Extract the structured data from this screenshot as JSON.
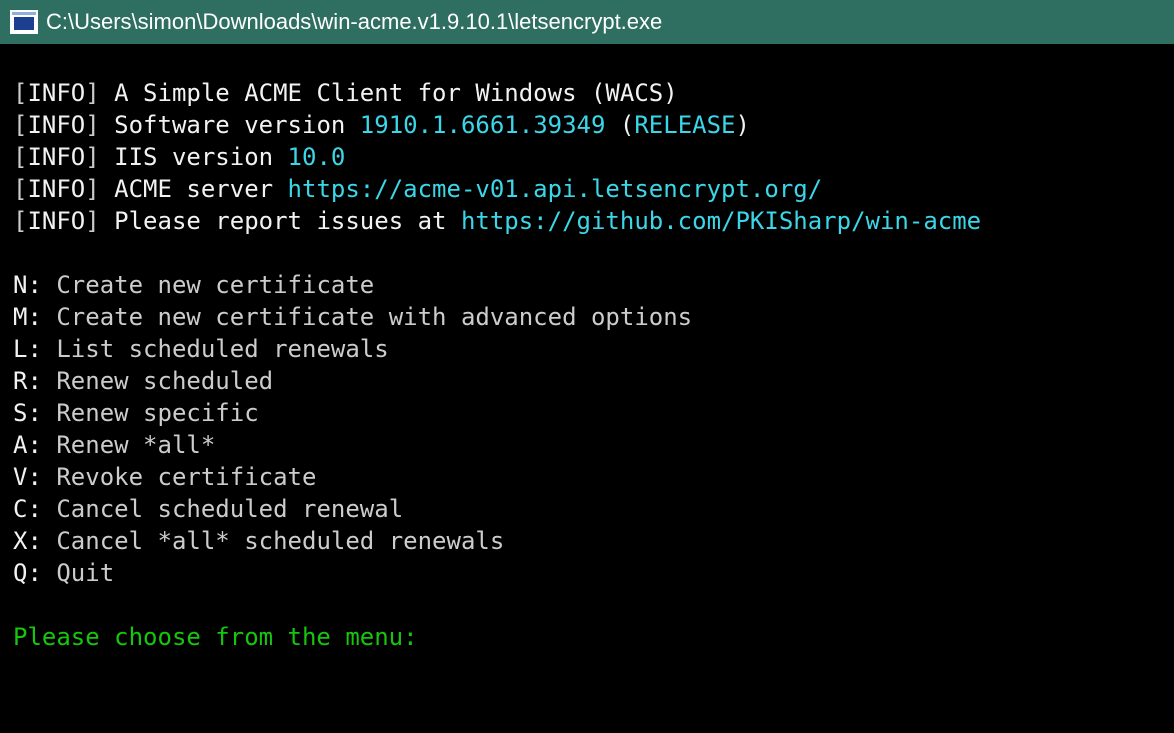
{
  "window": {
    "title": "C:\\Users\\simon\\Downloads\\win-acme.v1.9.10.1\\letsencrypt.exe",
    "title_color": "#2e6f62"
  },
  "colors": {
    "background": "#000000",
    "text": "#cccccc",
    "bright": "#f2f2f2",
    "cyan": "#3bd6e8",
    "green": "#16c60c"
  },
  "info": {
    "open": "[",
    "tag": "INFO",
    "close": "]",
    "line1": "A Simple ACME Client for Windows (WACS)",
    "line2_text": "Software version ",
    "line2_version": "1910.1.6661.39349",
    "line2_open": " (",
    "line2_build": "RELEASE",
    "line2_close": ")",
    "line3_text": "IIS version ",
    "line3_version": "10.0",
    "line4_text": "ACME server ",
    "line4_url": "https://acme-v01.api.letsencrypt.org/",
    "line5_text": "Please report issues at ",
    "line5_url": "https://github.com/PKISharp/win-acme"
  },
  "menu": [
    {
      "key": "N:",
      "label": "Create new certificate"
    },
    {
      "key": "M:",
      "label": "Create new certificate with advanced options"
    },
    {
      "key": "L:",
      "label": "List scheduled renewals"
    },
    {
      "key": "R:",
      "label": "Renew scheduled"
    },
    {
      "key": "S:",
      "label": "Renew specific"
    },
    {
      "key": "A:",
      "label": "Renew *all*"
    },
    {
      "key": "V:",
      "label": "Revoke certificate"
    },
    {
      "key": "C:",
      "label": "Cancel scheduled renewal"
    },
    {
      "key": "X:",
      "label": "Cancel *all* scheduled renewals"
    },
    {
      "key": "Q:",
      "label": "Quit"
    }
  ],
  "prompt": "Please choose from the menu:"
}
